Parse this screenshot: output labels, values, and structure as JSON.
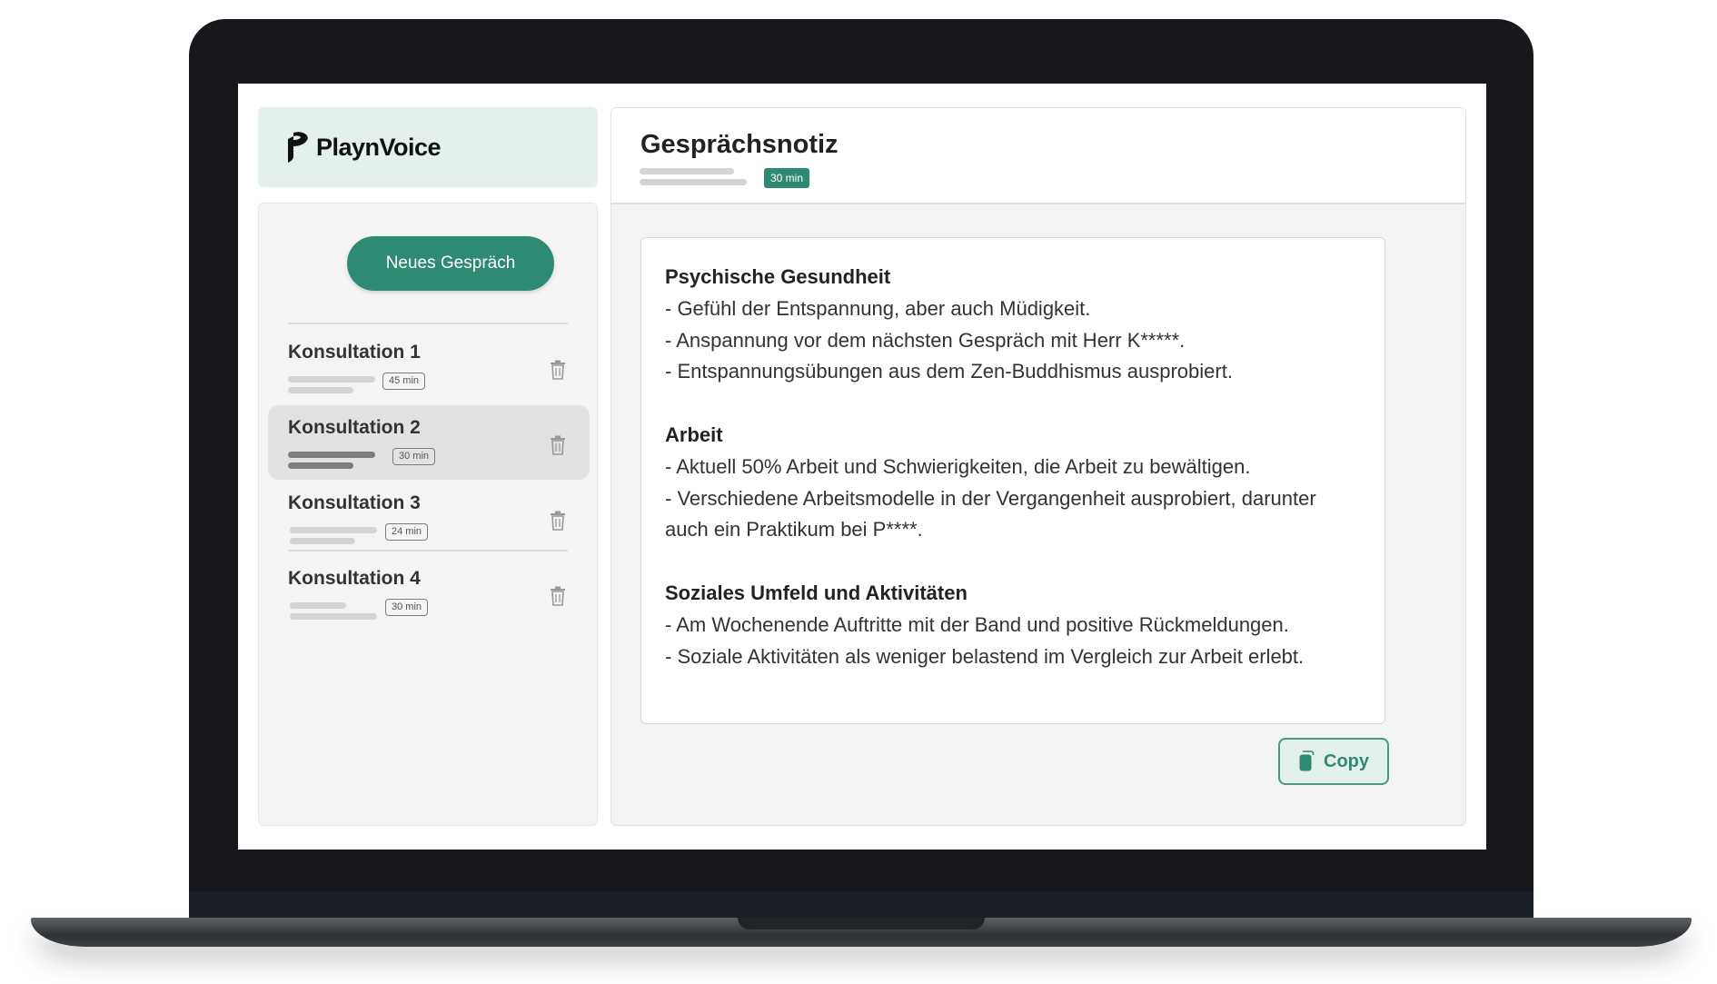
{
  "app": {
    "name": "PlaynVoice"
  },
  "sidebar": {
    "new_button_label": "Neues Gespräch",
    "conversations": [
      {
        "title": "Konsultation 1",
        "duration": "45 min",
        "active": false
      },
      {
        "title": "Konsultation 2",
        "duration": "30 min",
        "active": true
      },
      {
        "title": "Konsultation 3",
        "duration": "24 min",
        "active": false
      },
      {
        "title": "Konsultation 4",
        "duration": "30 min",
        "active": false
      }
    ]
  },
  "main": {
    "title": "Gesprächsnotiz",
    "duration": "30 min",
    "note": {
      "sections": [
        {
          "heading": "Psychische Gesundheit",
          "lines": [
            "- Gefühl der Entspannung, aber auch Müdigkeit.",
            "- Anspannung vor dem nächsten Gespräch mit Herr K*****.",
            "- Entspannungsübungen aus dem Zen-Buddhismus ausprobiert."
          ]
        },
        {
          "heading": "Arbeit",
          "lines": [
            "- Aktuell 50% Arbeit und Schwierigkeiten, die Arbeit zu bewältigen.",
            "- Verschiedene Arbeitsmodelle in der Vergangenheit ausprobiert, darunter auch ein Praktikum bei P****."
          ]
        },
        {
          "heading": "Soziales Umfeld und Aktivitäten",
          "lines": [
            "- Am Wochenende Auftritte mit der Band und positive Rückmeldungen.",
            "- Soziale Aktivitäten als weniger belastend im Vergleich zur Arbeit erlebt."
          ]
        }
      ]
    },
    "copy_label": "Copy"
  },
  "colors": {
    "accent": "#2e8a72",
    "accent_light": "#e4f0ec",
    "sidebar_bg": "#f4f4f4"
  },
  "icons": {
    "logo": "playnvoice-logo-icon",
    "delete": "trash-icon",
    "copy": "copy-icon"
  }
}
